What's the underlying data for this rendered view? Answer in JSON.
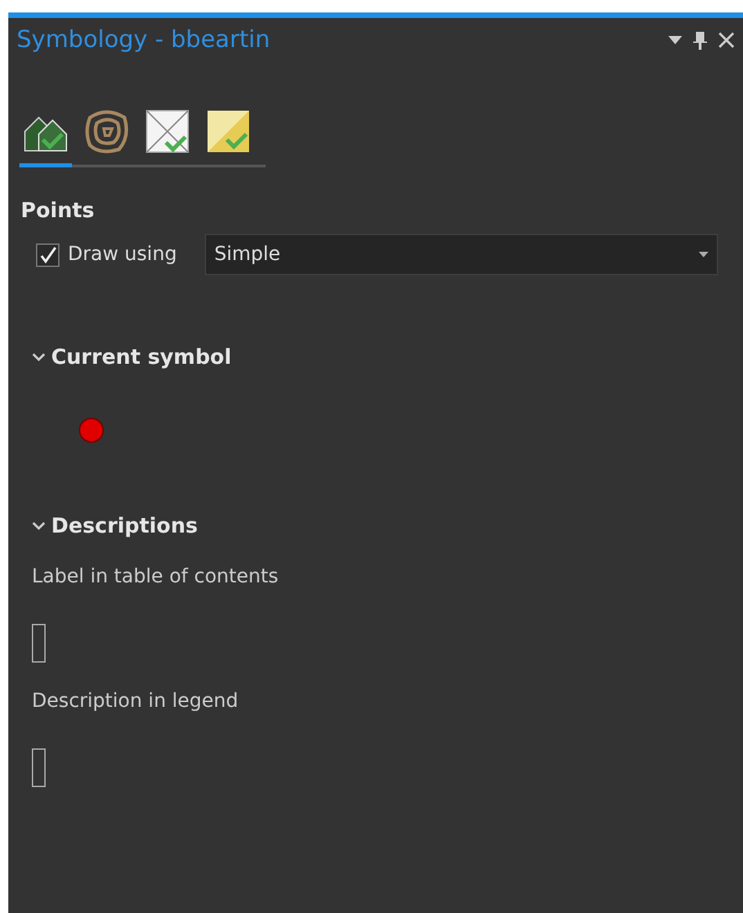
{
  "pane": {
    "title": "Symbology - bbeartin"
  },
  "tabs": [
    {
      "kind": "primary",
      "selected": true
    },
    {
      "kind": "contour",
      "selected": false
    },
    {
      "kind": "vary",
      "selected": false
    },
    {
      "kind": "rotation",
      "selected": false
    }
  ],
  "section_title": "Points",
  "draw_using": {
    "label": "Draw using",
    "checked": true,
    "value": "Simple"
  },
  "current_symbol": {
    "title": "Current symbol",
    "expanded": true,
    "color": "#e00000"
  },
  "descriptions": {
    "title": "Descriptions",
    "expanded": true,
    "fields": [
      {
        "label": "Label in table of contents"
      },
      {
        "label": "Description in legend"
      }
    ]
  }
}
